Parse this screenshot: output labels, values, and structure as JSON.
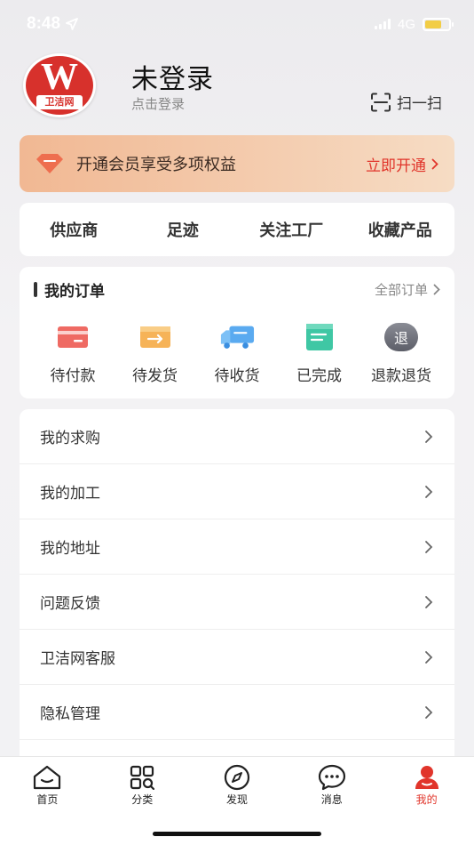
{
  "status_bar": {
    "time": "8:48",
    "network": "4G",
    "battery_color": "#f2cd45"
  },
  "profile": {
    "logo_letter": "W",
    "logo_text": "卫洁网",
    "title": "未登录",
    "subtitle": "点击登录",
    "scan_label": "扫一扫"
  },
  "vip_banner": {
    "text": "开通会员享受多项权益",
    "action": "立即开通",
    "icon": "diamond-icon",
    "accent": "#e1352b"
  },
  "shortcuts": [
    {
      "label": "供应商"
    },
    {
      "label": "足迹"
    },
    {
      "label": "关注工厂"
    },
    {
      "label": "收藏产品"
    }
  ],
  "orders": {
    "title": "我的订单",
    "all_label": "全部订单",
    "items": [
      {
        "label": "待付款",
        "icon": "wallet-icon"
      },
      {
        "label": "待发货",
        "icon": "box-arrow-icon"
      },
      {
        "label": "待收货",
        "icon": "truck-icon"
      },
      {
        "label": "已完成",
        "icon": "document-icon"
      },
      {
        "label": "退款退货",
        "icon": "refund-icon",
        "icon_text": "退"
      }
    ]
  },
  "menu": [
    {
      "label": "我的求购"
    },
    {
      "label": "我的加工"
    },
    {
      "label": "我的地址"
    },
    {
      "label": "问题反馈"
    },
    {
      "label": "卫洁网客服"
    },
    {
      "label": "隐私管理"
    },
    {
      "label": ""
    }
  ],
  "tabbar": {
    "active_color": "#e1352b",
    "tabs": [
      {
        "label": "首页",
        "icon": "home-icon",
        "active": false
      },
      {
        "label": "分类",
        "icon": "category-icon",
        "active": false
      },
      {
        "label": "发现",
        "icon": "compass-icon",
        "active": false
      },
      {
        "label": "消息",
        "icon": "message-icon",
        "active": false
      },
      {
        "label": "我的",
        "icon": "person-icon",
        "active": true
      }
    ]
  }
}
